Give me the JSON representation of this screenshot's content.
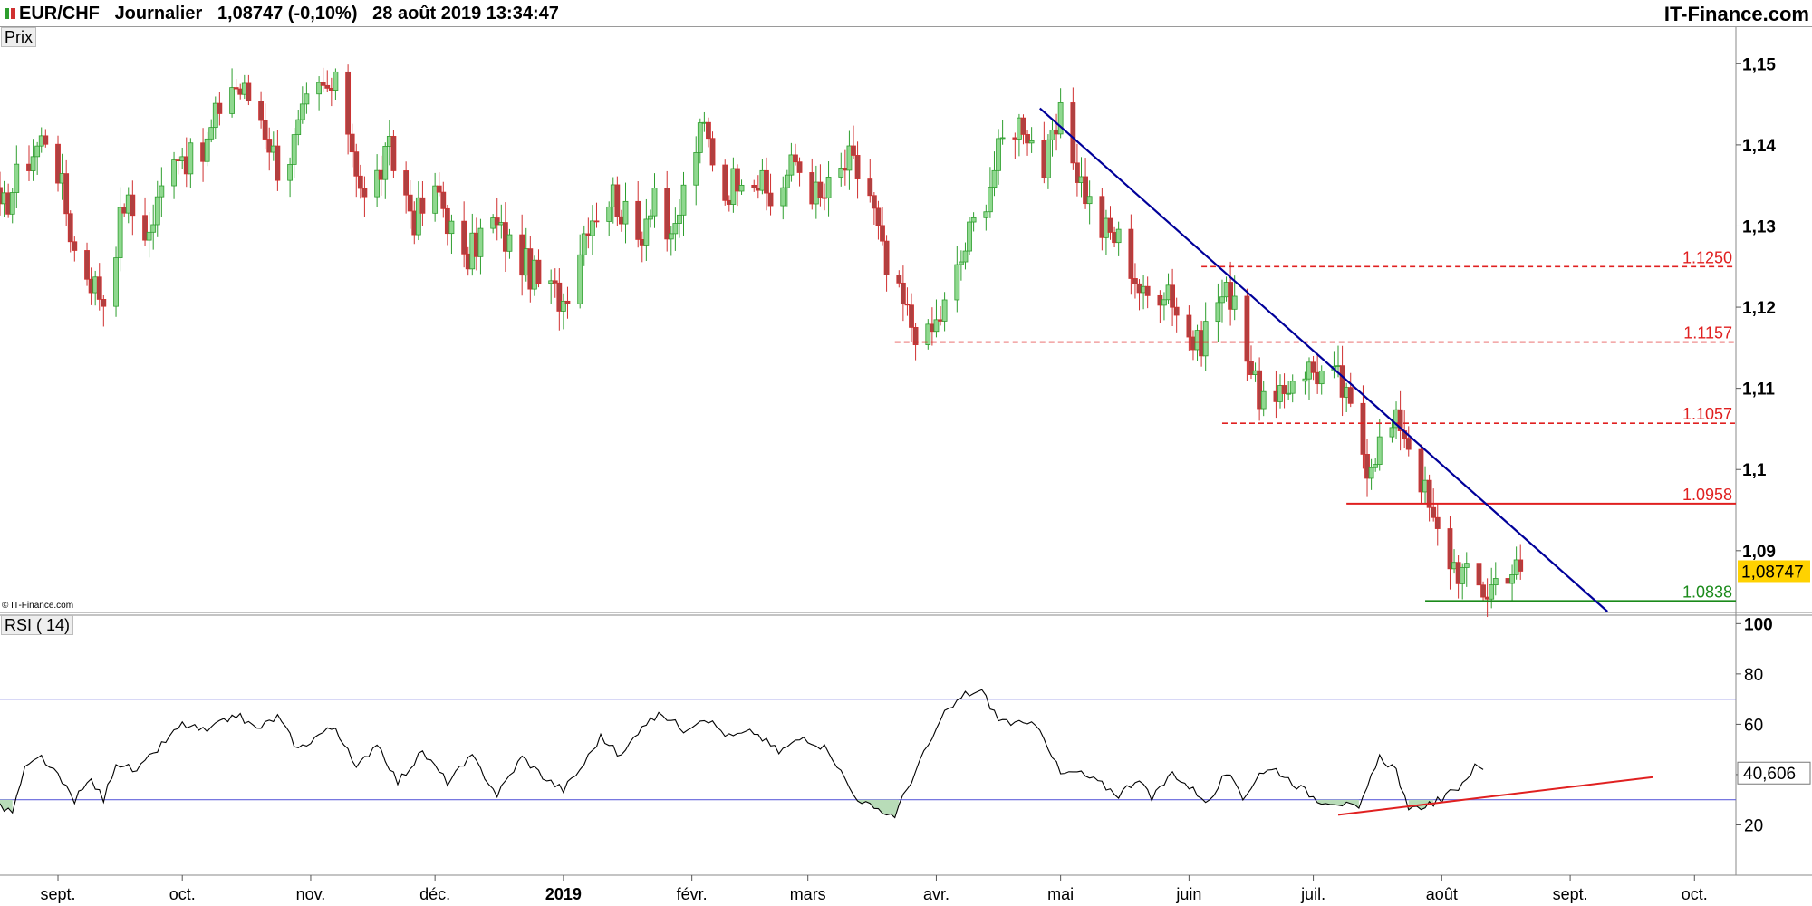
{
  "header": {
    "symbol": "EUR/CHF",
    "period": "Journalier",
    "last_price": "1,08747",
    "change": "(-0,10%)",
    "datetime": "28 août 2019 13:34:47",
    "site": "IT-Finance.com"
  },
  "copyright": "© IT-Finance.com",
  "colors": {
    "up": "#2e9e2e",
    "up_body": "#8fd88f",
    "down": "#d03030",
    "down_body": "#b04040",
    "trendline": "#00009a",
    "resistance": "#e02020",
    "support": "#1a8a1a",
    "price_badge": "#ffd200",
    "rsi_line": "#000000",
    "rsi_band": "#6464dc",
    "rsi_trend": "#e02020"
  },
  "chart_data": [
    {
      "type": "candlestick",
      "title": "Prix",
      "ylim": [
        1.0825,
        1.1545
      ],
      "yticks": [
        {
          "v": 1.15,
          "label": "1,15"
        },
        {
          "v": 1.14,
          "label": "1,14"
        },
        {
          "v": 1.13,
          "label": "1,13"
        },
        {
          "v": 1.12,
          "label": "1,12"
        },
        {
          "v": 1.11,
          "label": "1,11"
        },
        {
          "v": 1.1,
          "label": "1,1"
        },
        {
          "v": 1.09,
          "label": "1,09"
        }
      ],
      "x_months": [
        {
          "t": 14,
          "label": "sept."
        },
        {
          "t": 44,
          "label": "oct."
        },
        {
          "t": 75,
          "label": "nov."
        },
        {
          "t": 105,
          "label": "déc."
        },
        {
          "t": 136,
          "label": "2019"
        },
        {
          "t": 167,
          "label": "févr."
        },
        {
          "t": 195,
          "label": "mars"
        },
        {
          "t": 226,
          "label": "avr."
        },
        {
          "t": 256,
          "label": "mai"
        },
        {
          "t": 287,
          "label": "juin"
        },
        {
          "t": 317,
          "label": "juil."
        },
        {
          "t": 348,
          "label": "août"
        },
        {
          "t": 379,
          "label": "sept."
        },
        {
          "t": 409,
          "label": "oct."
        }
      ],
      "xlim": [
        0,
        419
      ],
      "anchors_close": [
        [
          0,
          1.131
        ],
        [
          5,
          1.137
        ],
        [
          12,
          1.142
        ],
        [
          18,
          1.127
        ],
        [
          25,
          1.121
        ],
        [
          30,
          1.133
        ],
        [
          36,
          1.129
        ],
        [
          42,
          1.14
        ],
        [
          48,
          1.137
        ],
        [
          55,
          1.148
        ],
        [
          62,
          1.145
        ],
        [
          68,
          1.136
        ],
        [
          75,
          1.146
        ],
        [
          82,
          1.147
        ],
        [
          88,
          1.133
        ],
        [
          94,
          1.139
        ],
        [
          100,
          1.131
        ],
        [
          106,
          1.134
        ],
        [
          112,
          1.125
        ],
        [
          118,
          1.131
        ],
        [
          124,
          1.127
        ],
        [
          130,
          1.123
        ],
        [
          136,
          1.121
        ],
        [
          142,
          1.131
        ],
        [
          148,
          1.134
        ],
        [
          154,
          1.128
        ],
        [
          158,
          1.135
        ],
        [
          162,
          1.127
        ],
        [
          167,
          1.139
        ],
        [
          170,
          1.142
        ],
        [
          175,
          1.134
        ],
        [
          180,
          1.138
        ],
        [
          186,
          1.133
        ],
        [
          192,
          1.138
        ],
        [
          198,
          1.133
        ],
        [
          205,
          1.138
        ],
        [
          210,
          1.134
        ],
        [
          214,
          1.124
        ],
        [
          220,
          1.118
        ],
        [
          224,
          1.116
        ],
        [
          229,
          1.121
        ],
        [
          234,
          1.129
        ],
        [
          238,
          1.134
        ],
        [
          243,
          1.142
        ],
        [
          247,
          1.143
        ],
        [
          252,
          1.137
        ],
        [
          256,
          1.143
        ],
        [
          260,
          1.137
        ],
        [
          265,
          1.13
        ],
        [
          271,
          1.128
        ],
        [
          276,
          1.121
        ],
        [
          282,
          1.123
        ],
        [
          285,
          1.118
        ],
        [
          289,
          1.115
        ],
        [
          294,
          1.121
        ],
        [
          298,
          1.122
        ],
        [
          303,
          1.11
        ],
        [
          308,
          1.107
        ],
        [
          313,
          1.113
        ],
        [
          318,
          1.112
        ],
        [
          323,
          1.111
        ],
        [
          326,
          1.107
        ],
        [
          330,
          1.101
        ],
        [
          334,
          1.104
        ],
        [
          338,
          1.106
        ],
        [
          342,
          1.101
        ],
        [
          346,
          1.093
        ],
        [
          350,
          1.089
        ],
        [
          355,
          1.086
        ],
        [
          359,
          1.085
        ],
        [
          363,
          1.088
        ],
        [
          367,
          1.0875
        ]
      ],
      "last_close": 1.08747,
      "last_close_label": "1,08747",
      "levels": [
        {
          "value": 1.125,
          "label": "1.1250",
          "style": "dashed",
          "x_from": 290
        },
        {
          "value": 1.1157,
          "label": "1.1157",
          "style": "dashed",
          "x_from": 216
        },
        {
          "value": 1.1057,
          "label": "1.1057",
          "style": "dashed",
          "x_from": 295
        },
        {
          "value": 1.0958,
          "label": "1.0958",
          "style": "solid",
          "x_from": 325
        },
        {
          "value": 1.0838,
          "label": "1.0838",
          "style": "solid_green",
          "x_from": 344
        }
      ],
      "trendline": {
        "from": [
          251,
          1.1445
        ],
        "to": [
          388,
          1.0825
        ]
      },
      "grid": false
    },
    {
      "type": "line",
      "title": "RSI ( 14)",
      "ylim": [
        0,
        103
      ],
      "yticks": [
        {
          "v": 100,
          "label": "100"
        },
        {
          "v": 80,
          "label": "80"
        },
        {
          "v": 60,
          "label": "60"
        },
        {
          "v": 40,
          "label": "40"
        },
        {
          "v": 20,
          "label": "20"
        }
      ],
      "bands": [
        70,
        30
      ],
      "last_value": 40.606,
      "last_value_label": "40,606",
      "anchors": [
        [
          0,
          27
        ],
        [
          3,
          25
        ],
        [
          6,
          42
        ],
        [
          10,
          47
        ],
        [
          14,
          39
        ],
        [
          18,
          30
        ],
        [
          22,
          38
        ],
        [
          25,
          30
        ],
        [
          28,
          45
        ],
        [
          33,
          41
        ],
        [
          38,
          50
        ],
        [
          44,
          60
        ],
        [
          50,
          57
        ],
        [
          57,
          64
        ],
        [
          62,
          58
        ],
        [
          67,
          63
        ],
        [
          72,
          50
        ],
        [
          77,
          56
        ],
        [
          81,
          59
        ],
        [
          86,
          42
        ],
        [
          91,
          53
        ],
        [
          96,
          37
        ],
        [
          102,
          49
        ],
        [
          108,
          37
        ],
        [
          114,
          47
        ],
        [
          120,
          32
        ],
        [
          126,
          47
        ],
        [
          132,
          38
        ],
        [
          136,
          34
        ],
        [
          140,
          42
        ],
        [
          145,
          55
        ],
        [
          150,
          47
        ],
        [
          155,
          60
        ],
        [
          160,
          64
        ],
        [
          165,
          58
        ],
        [
          170,
          63
        ],
        [
          176,
          55
        ],
        [
          182,
          57
        ],
        [
          188,
          49
        ],
        [
          194,
          55
        ],
        [
          200,
          50
        ],
        [
          206,
          32
        ],
        [
          212,
          25
        ],
        [
          216,
          24
        ],
        [
          222,
          45
        ],
        [
          228,
          64
        ],
        [
          233,
          72
        ],
        [
          237,
          73
        ],
        [
          241,
          62
        ],
        [
          246,
          60
        ],
        [
          251,
          59
        ],
        [
          256,
          40
        ],
        [
          260,
          41
        ],
        [
          265,
          37
        ],
        [
          270,
          32
        ],
        [
          275,
          39
        ],
        [
          278,
          30
        ],
        [
          283,
          41
        ],
        [
          287,
          35
        ],
        [
          292,
          29
        ],
        [
          296,
          41
        ],
        [
          300,
          30
        ],
        [
          304,
          41
        ],
        [
          308,
          42
        ],
        [
          312,
          37
        ],
        [
          318,
          30
        ],
        [
          323,
          29
        ],
        [
          328,
          26
        ],
        [
          333,
          47
        ],
        [
          337,
          42
        ],
        [
          340,
          25
        ],
        [
          344,
          28
        ],
        [
          348,
          30
        ],
        [
          352,
          35
        ],
        [
          356,
          43
        ],
        [
          358,
          42
        ]
      ],
      "trendline": {
        "from": [
          323,
          24
        ],
        "to": [
          399,
          39
        ]
      }
    }
  ]
}
